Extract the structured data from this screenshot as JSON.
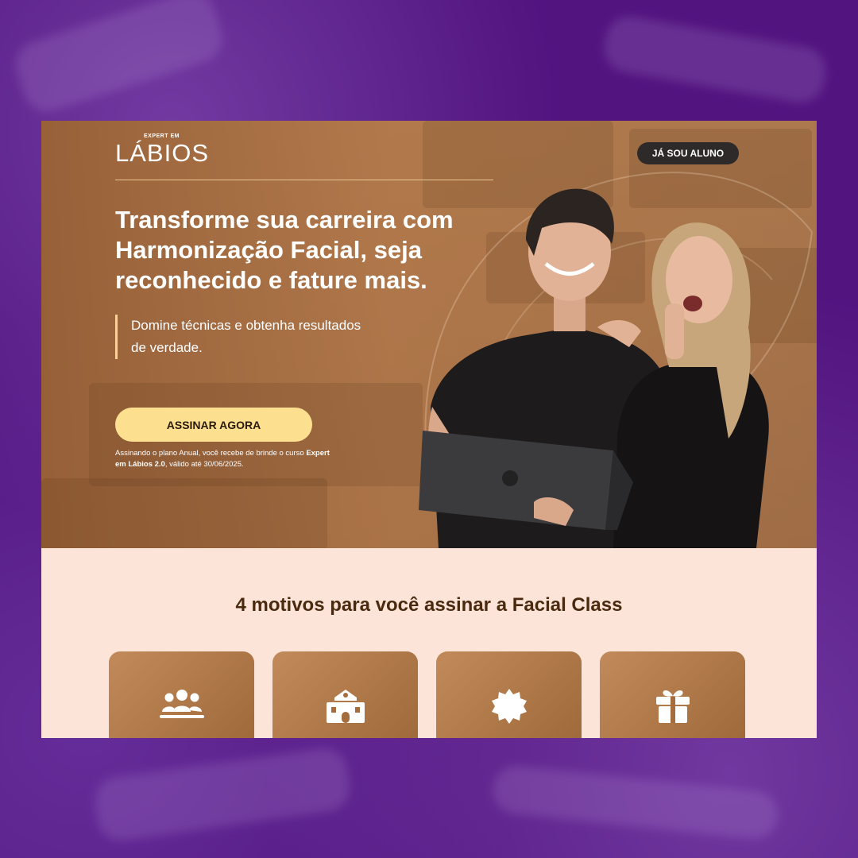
{
  "header": {
    "logo_small": "EXPERT EM",
    "logo_big": "LÁBIOS",
    "login_button": "JÁ SOU ALUNO"
  },
  "hero": {
    "headline": "Transforme sua carreira com Harmonização Facial, seja reconhecido e fature mais.",
    "subheadline": "Domine técnicas e obtenha resultados de verdade.",
    "cta_button": "ASSINAR AGORA",
    "note_prefix": "Assinando o plano Anual, você recebe de brinde o curso ",
    "note_bold": "Expert em Lábios 2.0",
    "note_suffix": ", válido até 30/06/2025."
  },
  "motivos": {
    "title": "4 motivos para você assinar a Facial Class",
    "cards": [
      {
        "icon": "community-icon"
      },
      {
        "icon": "school-icon"
      },
      {
        "icon": "badge-icon"
      },
      {
        "icon": "gift-icon"
      }
    ]
  },
  "colors": {
    "background_purple": "#52147f",
    "hero_brown": "#b07a4f",
    "cta_yellow": "#fde08f",
    "section_peach": "#fde4d8",
    "title_brown": "#4a2a0f"
  }
}
